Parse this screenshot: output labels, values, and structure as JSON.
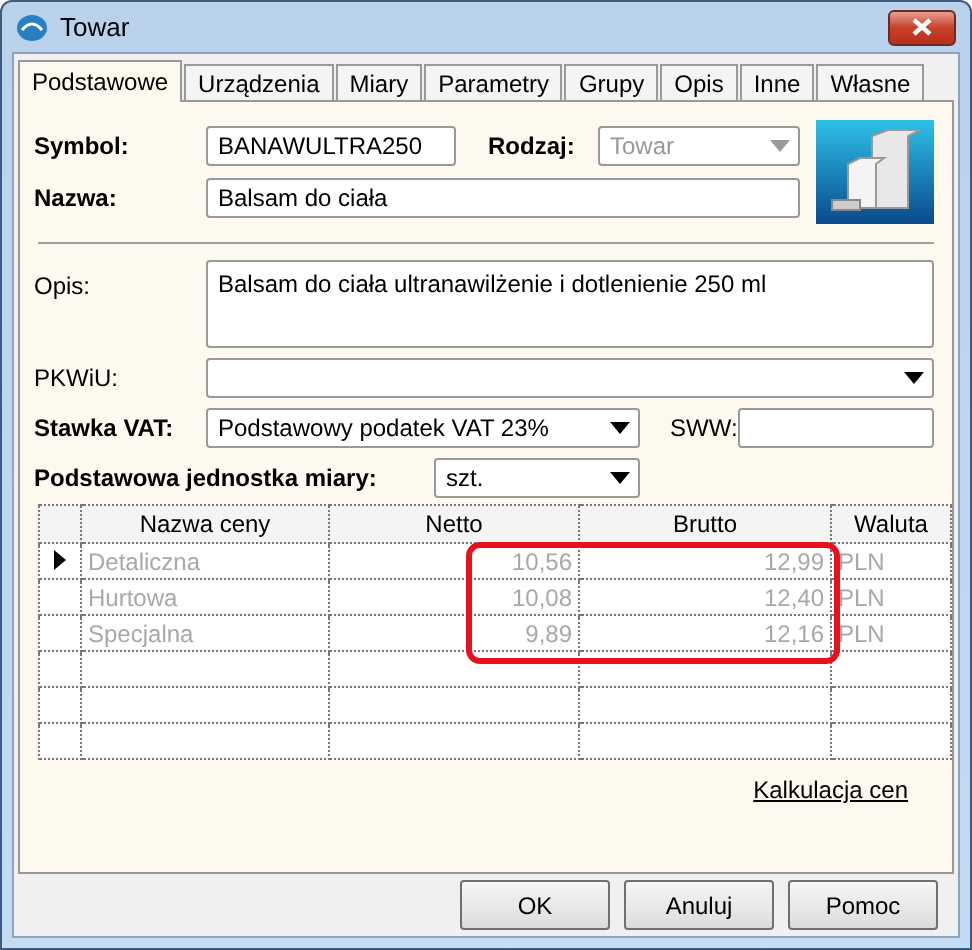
{
  "window": {
    "title": "Towar"
  },
  "tabs": [
    {
      "label": "Podstawowe",
      "selected": true
    },
    {
      "label": "Urządzenia",
      "selected": false
    },
    {
      "label": "Miary",
      "selected": false
    },
    {
      "label": "Parametry",
      "selected": false
    },
    {
      "label": "Grupy",
      "selected": false
    },
    {
      "label": "Opis",
      "selected": false
    },
    {
      "label": "Inne",
      "selected": false
    },
    {
      "label": "Własne",
      "selected": false
    }
  ],
  "form": {
    "symbol": {
      "label": "Symbol:",
      "value": "BANAWULTRA250"
    },
    "rodzaj": {
      "label": "Rodzaj:",
      "value": "Towar",
      "disabled": true
    },
    "nazwa": {
      "label": "Nazwa:",
      "value": "Balsam do ciała"
    },
    "opis": {
      "label": "Opis:",
      "value": "Balsam do ciała ultranawilżenie i dotlenienie 250 ml"
    },
    "pkwiu": {
      "label": "PKWiU:"
    },
    "stawka_vat": {
      "label": "Stawka VAT:",
      "value": "Podstawowy podatek VAT 23%"
    },
    "sww": {
      "label": "SWW:"
    },
    "jednostka": {
      "label": "Podstawowa jednostka miary:",
      "value": "szt."
    }
  },
  "price_table": {
    "columns": [
      "Nazwa ceny",
      "Netto",
      "Brutto",
      "Waluta"
    ],
    "rows": [
      {
        "selected": true,
        "disabled": true,
        "cells": [
          "Detaliczna",
          "10,56",
          "12,99",
          "PLN"
        ]
      },
      {
        "selected": false,
        "disabled": true,
        "cells": [
          "Hurtowa",
          "10,08",
          "12,40",
          "PLN"
        ]
      },
      {
        "selected": false,
        "disabled": true,
        "cells": [
          "Specjalna",
          "9,89",
          "12,16",
          "PLN"
        ]
      }
    ],
    "highlight": {
      "kind": "rounded-frame"
    }
  },
  "link": "Kalkulacja cen",
  "buttons": [
    "OK",
    "Anuluj",
    "Pomoc"
  ]
}
